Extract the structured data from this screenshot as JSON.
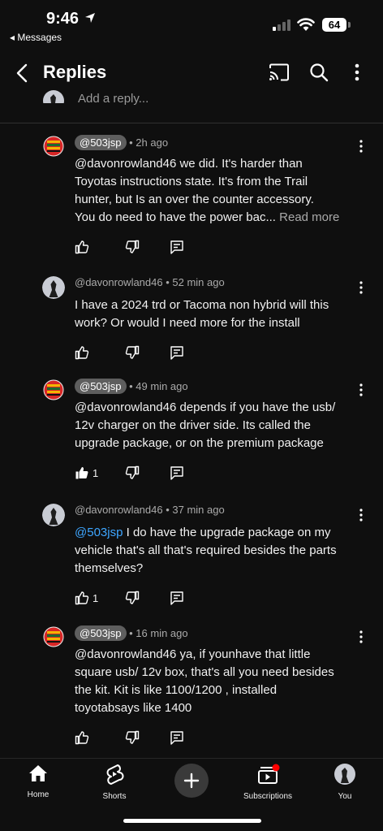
{
  "status_bar": {
    "time": "9:46",
    "back_app": "◂ Messages",
    "battery": "64"
  },
  "header": {
    "title": "Replies"
  },
  "add_reply": {
    "placeholder": "Add a reply..."
  },
  "comments": [
    {
      "author": "@503jsp",
      "author_style": "pill",
      "time": "• 2h ago",
      "lines": [
        "@davonrowland46   we did. It's harder than",
        "Toyotas instructions state. It's from the Trail",
        "hunter, but Is an over the counter accessory.",
        "You do need to have the power bac..."
      ],
      "read_more": "Read more",
      "likes": "",
      "liked": false
    },
    {
      "author": "@davonrowland46",
      "author_style": "plain",
      "time": "• 52 min ago",
      "lines": [
        "I have a 2024 trd or Tacoma non hybrid will this",
        "work? Or would I need more for the install"
      ],
      "likes": "",
      "liked": false
    },
    {
      "author": "@503jsp",
      "author_style": "pill",
      "time": "• 49 min ago",
      "lines": [
        "@davonrowland46  depends if you have the usb/",
        "12v  charger on the driver side. Its called the",
        "upgrade package, or on the premium package"
      ],
      "likes": "1",
      "liked": true
    },
    {
      "author": "@davonrowland46",
      "author_style": "plain",
      "time": "• 37 min ago",
      "mention": "@503jsp",
      "lines": [
        " I do have the upgrade package on my",
        "vehicle that's all that's required besides the parts",
        "themselves?"
      ],
      "likes": "1",
      "liked": false
    },
    {
      "author": "@503jsp",
      "author_style": "pill",
      "time": "• 16 min ago",
      "lines": [
        "@davonrowland46  ya, if younhave that little",
        "square usb/ 12v box, that's all you need besides",
        "the kit. Kit is like 1100/1200 , installed",
        "toyotabsays like 1400"
      ],
      "likes": "",
      "liked": false
    }
  ],
  "bottom_nav": {
    "home": "Home",
    "shorts": "Shorts",
    "subscriptions": "Subscriptions",
    "you": "You"
  },
  "colors": {
    "background": "#0f0f0f",
    "mention": "#3ea6ff",
    "badge": "#ff0000"
  }
}
